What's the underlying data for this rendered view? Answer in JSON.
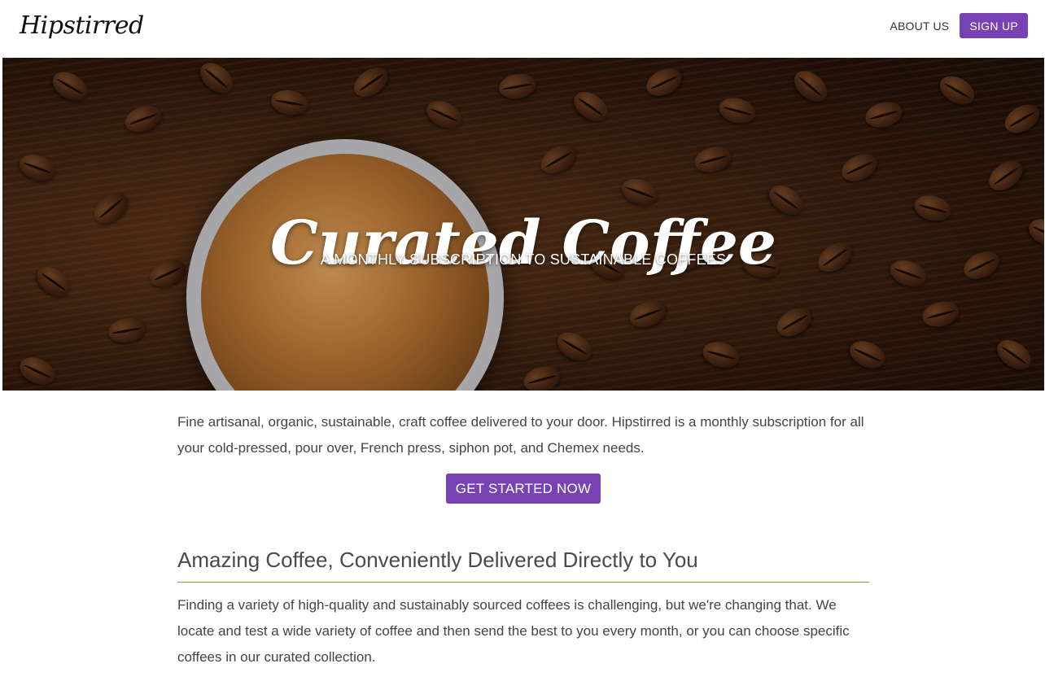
{
  "header": {
    "logo": "Hipstirred",
    "nav": {
      "about_label": "ABOUT US",
      "signup_label": "SIGN UP"
    }
  },
  "hero": {
    "title": "Curated Coffee",
    "subtitle": "A MONTHLY SUBSCRIPTION TO SUSTAINABLE COFFEES"
  },
  "main": {
    "intro": "Fine artisanal, organic, sustainable, craft coffee delivered to your door. Hipstirred is a monthly subscription for all your cold-pressed, pour over, French press, siphon pot, and Chemex needs.",
    "cta_label": "GET STARTED NOW",
    "section": {
      "title": "Amazing Coffee, Conveniently Delivered Directly to You",
      "body": "Finding a variety of high-quality and sustainably sourced coffees is challenging, but we're changing that. We locate and test a wide variety of coffee and then send the best to you every month, or you can choose specific coffees in our curated collection."
    }
  },
  "colors": {
    "accent": "#7742b2",
    "divider": "#a08a4a",
    "text": "#444444"
  }
}
